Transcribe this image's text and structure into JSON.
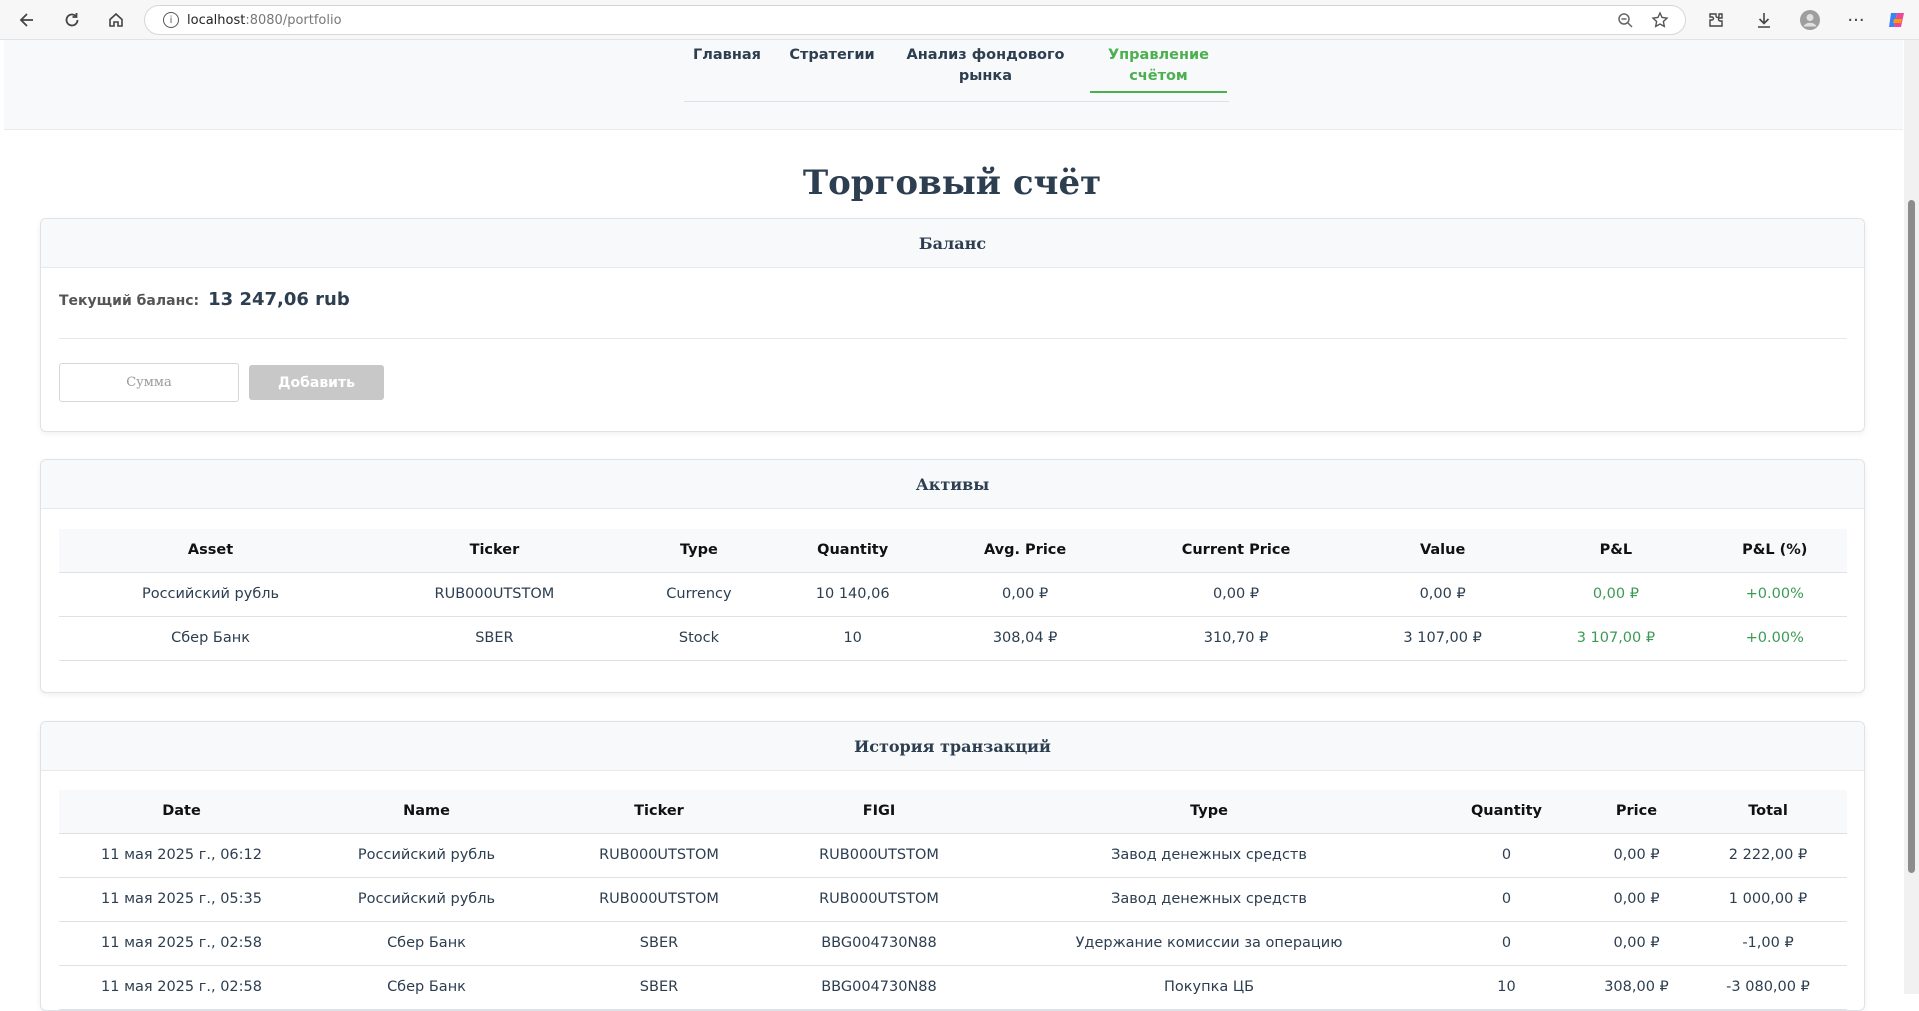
{
  "browser": {
    "url_host": "localhost",
    "url_path": ":8080/portfolio"
  },
  "nav": {
    "items": [
      {
        "label_line1": "Главная",
        "label_line2": ""
      },
      {
        "label_line1": "Стратегии",
        "label_line2": ""
      },
      {
        "label_line1": "Анализ фондового",
        "label_line2": "рынка"
      },
      {
        "label_line1": "Управление",
        "label_line2": "счётом"
      }
    ],
    "active_index": 3,
    "active_color": "#4caf50"
  },
  "page": {
    "title": "Торговый счёт"
  },
  "balance_card": {
    "header": "Баланс",
    "label": "Текущий баланс:",
    "value": "13 247,06 rub",
    "input_placeholder": "Сумма",
    "button_label": "Добавить"
  },
  "assets_card": {
    "header": "Активы",
    "columns": [
      "Asset",
      "Ticker",
      "Type",
      "Quantity",
      "Avg. Price",
      "Current Price",
      "Value",
      "P&L",
      "P&L (%)"
    ],
    "rows": [
      [
        "Российский рубль",
        "RUB000UTSTOM",
        "Currency",
        "10 140,06",
        "0,00 ₽",
        "0,00 ₽",
        "0,00 ₽",
        "0,00 ₽",
        "+0.00%"
      ],
      [
        "Сбер Банк",
        "SBER",
        "Stock",
        "10",
        "308,04 ₽",
        "310,70 ₽",
        "3 107,00 ₽",
        "3 107,00 ₽",
        "+0.00%"
      ]
    ]
  },
  "transactions_card": {
    "header": "История транзакций",
    "columns": [
      "Date",
      "Name",
      "Ticker",
      "FIGI",
      "Type",
      "Quantity",
      "Price",
      "Total"
    ],
    "rows": [
      [
        "11 мая 2025 г., 06:12",
        "Российский рубль",
        "RUB000UTSTOM",
        "RUB000UTSTOM",
        "Завод денежных средств",
        "0",
        "0,00 ₽",
        "2 222,00 ₽"
      ],
      [
        "11 мая 2025 г., 05:35",
        "Российский рубль",
        "RUB000UTSTOM",
        "RUB000UTSTOM",
        "Завод денежных средств",
        "0",
        "0,00 ₽",
        "1 000,00 ₽"
      ],
      [
        "11 мая 2025 г., 02:58",
        "Сбер Банк",
        "SBER",
        "BBG004730N88",
        "Удержание комиссии за операцию",
        "0",
        "0,00 ₽",
        "-1,00 ₽"
      ],
      [
        "11 мая 2025 г., 02:58",
        "Сбер Банк",
        "SBER",
        "BBG004730N88",
        "Покупка ЦБ",
        "10",
        "308,00 ₽",
        "-3 080,00 ₽"
      ]
    ]
  },
  "colors": {
    "positive": "#3c9a55",
    "title": "#2c3e50"
  },
  "icons": [
    "back-icon",
    "reload-icon",
    "home-icon",
    "info-icon",
    "zoom-icon",
    "star-icon",
    "extensions-icon",
    "download-icon",
    "profile-icon",
    "more-icon",
    "copilot-icon"
  ]
}
